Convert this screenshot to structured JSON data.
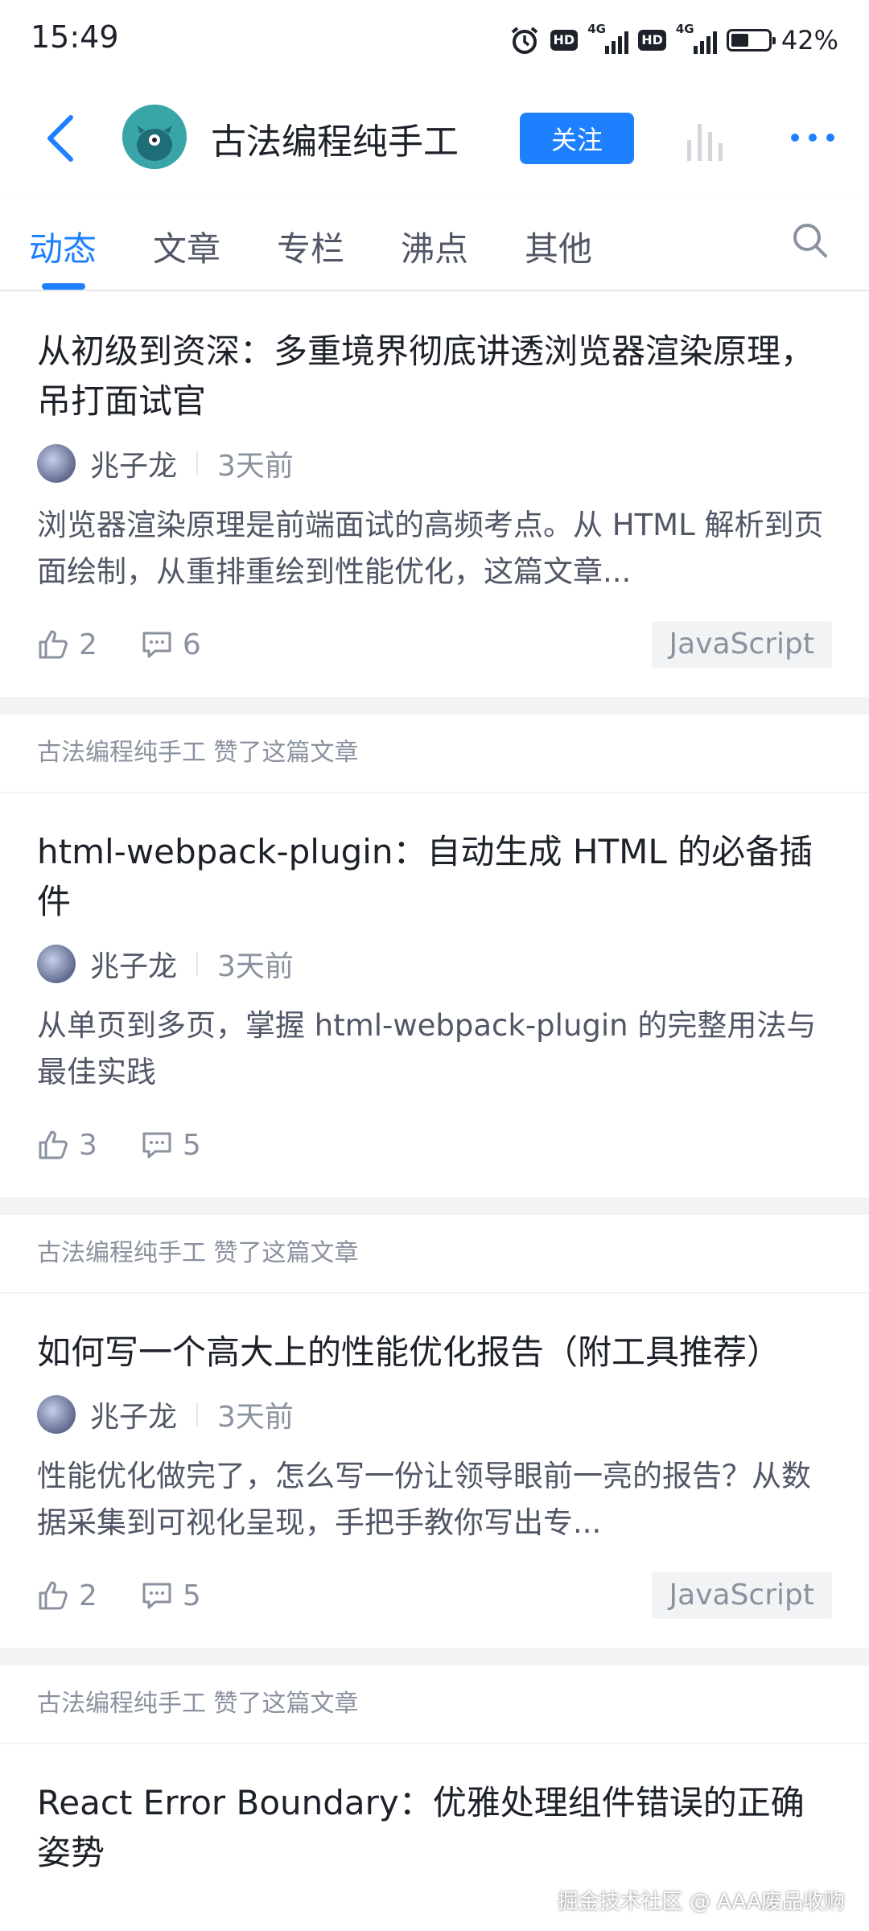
{
  "status": {
    "time": "15:49",
    "battery": "42%",
    "net": "4G",
    "hd": "HD"
  },
  "header": {
    "name": "古法编程纯手工",
    "follow_label": "关注"
  },
  "tabs": [
    "动态",
    "文章",
    "专栏",
    "沸点",
    "其他"
  ],
  "feed": [
    {
      "liked_text": "",
      "title": "从初级到资深：多重境界彻底讲透浏览器渲染原理，吊打面试官",
      "author": "兆子龙",
      "time": "3天前",
      "brief": "浏览器渲染原理是前端面试的高频考点。从 HTML 解析到页面绘制，从重排重绘到性能优化，这篇文章...",
      "likes": "2",
      "comments": "6",
      "tag": "JavaScript"
    },
    {
      "liked_text": "古法编程纯手工 赞了这篇文章",
      "title": "html-webpack-plugin：自动生成 HTML 的必备插件",
      "author": "兆子龙",
      "time": "3天前",
      "brief": "从单页到多页，掌握 html-webpack-plugin 的完整用法与最佳实践",
      "likes": "3",
      "comments": "5",
      "tag": ""
    },
    {
      "liked_text": "古法编程纯手工 赞了这篇文章",
      "title": "如何写一个高大上的性能优化报告（附工具推荐）",
      "author": "兆子龙",
      "time": "3天前",
      "brief": "性能优化做完了，怎么写一份让领导眼前一亮的报告？从数据采集到可视化呈现，手把手教你写出专...",
      "likes": "2",
      "comments": "5",
      "tag": "JavaScript"
    },
    {
      "liked_text": "古法编程纯手工 赞了这篇文章",
      "title": "React Error Boundary：优雅处理组件错误的正确姿势",
      "author": "",
      "time": "",
      "brief": "",
      "likes": "",
      "comments": "",
      "tag": ""
    }
  ],
  "watermark": "掘金技术社区 @ AAA废品收购",
  "colors": {
    "accent": "#1e80ff",
    "text": "#1d2129",
    "muted": "#8a919f"
  }
}
